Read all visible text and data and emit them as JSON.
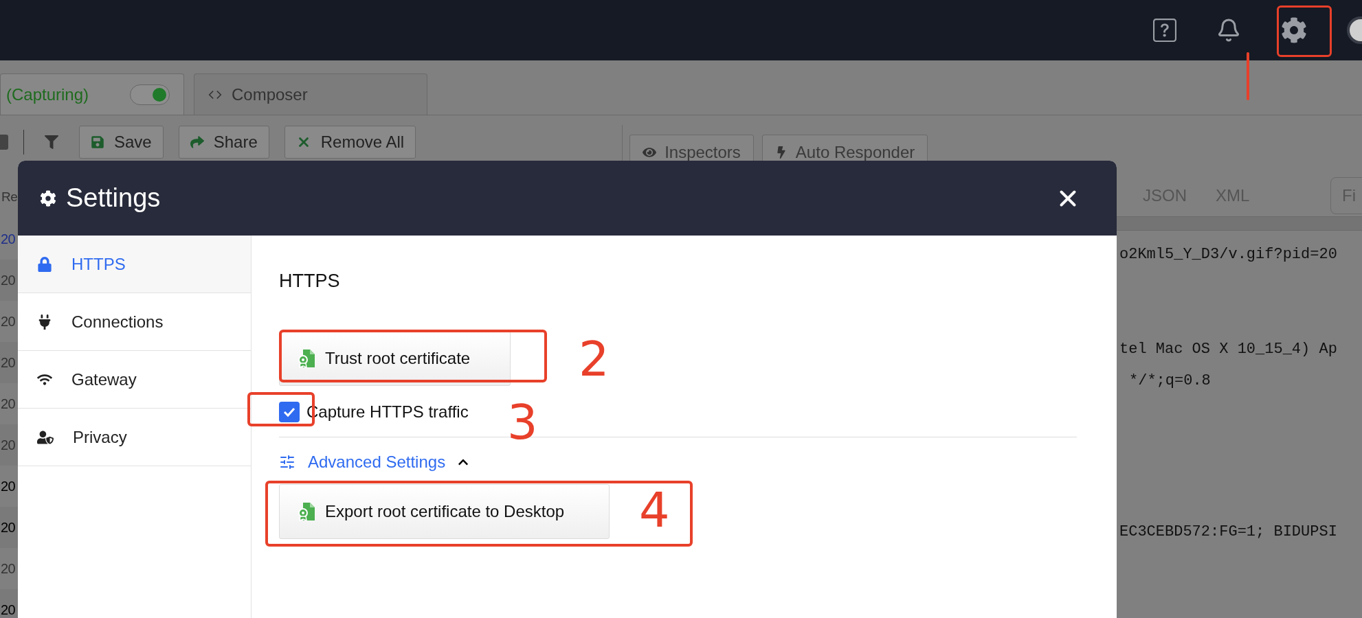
{
  "top_bar": {
    "avatar": true
  },
  "tabs": [
    {
      "label": "(Capturing)",
      "kind": "capture",
      "selected": true,
      "capturing": true
    },
    {
      "label": "Composer",
      "kind": "composer",
      "selected": false
    }
  ],
  "toolbar": {
    "buttons": [
      {
        "label": "Save",
        "kind": "save"
      },
      {
        "label": "Share",
        "kind": "share"
      },
      {
        "label": "Remove All",
        "kind": "remove"
      }
    ]
  },
  "inspector_tabs": [
    {
      "label": "Inspectors",
      "kind": "inspectors"
    },
    {
      "label": "Auto Responder",
      "kind": "responder"
    }
  ],
  "sessions": {
    "column_1": "Re",
    "rows": [
      {
        "text": "20",
        "color": "#1f2f8a"
      },
      {
        "text": "20",
        "color": "#333333"
      },
      {
        "text": "20",
        "color": "#333333"
      },
      {
        "text": "20",
        "color": "#333333"
      },
      {
        "text": "20",
        "color": "#333333"
      },
      {
        "text": "20",
        "color": "#333333"
      },
      {
        "text": "20",
        "color": "#000000"
      },
      {
        "text": "20",
        "color": "#000000"
      },
      {
        "text": "20",
        "color": "#333333"
      },
      {
        "text": "20",
        "color": "#000000"
      }
    ]
  },
  "viewer": {
    "tabs": [
      "JSON",
      "XML"
    ],
    "find_placeholder": "Fi",
    "lines": [
      {
        "text": "o2Kml5_Y_D3/v.gif?pid=20"
      },
      {
        "text": "tel Mac OS X 10_15_4) Ap"
      },
      {
        "text": "*/*;q=0.8"
      },
      {
        "text": "EC3CEBD572:FG=1; BIDUPSI"
      }
    ]
  },
  "dialog": {
    "title": "Settings",
    "sidebar": [
      {
        "label": "HTTPS",
        "kind": "lock",
        "selected": true
      },
      {
        "label": "Connections",
        "kind": "plug",
        "selected": false
      },
      {
        "label": "Gateway",
        "kind": "wifi",
        "selected": false
      },
      {
        "label": "Privacy",
        "kind": "privacy",
        "selected": false
      }
    ],
    "heading": "HTTPS",
    "trust_button": "Trust root certificate",
    "capture_checkbox": {
      "label": "Capture HTTPS traffic",
      "checked": true
    },
    "advanced": {
      "label": "Advanced Settings",
      "expanded": true
    },
    "export_button": "Export root certificate to Desktop"
  },
  "annotations": [
    {
      "number": "2"
    },
    {
      "number": "3"
    },
    {
      "number": "4"
    }
  ]
}
